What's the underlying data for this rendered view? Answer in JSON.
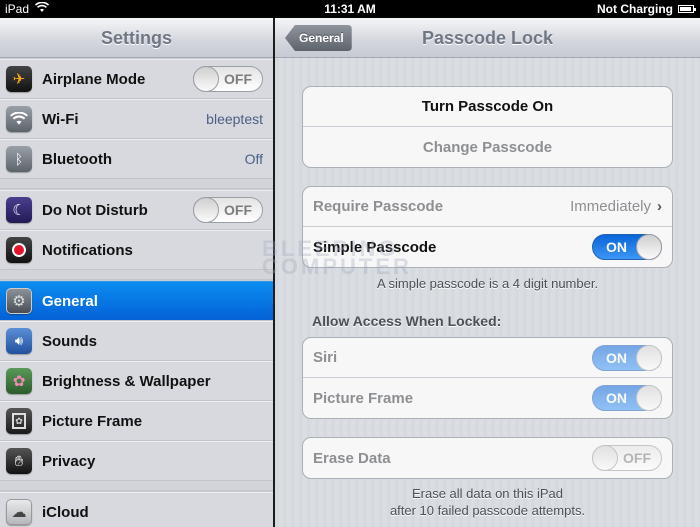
{
  "status_bar": {
    "device": "iPad",
    "time": "11:31 AM",
    "battery_text": "Not Charging"
  },
  "sidebar": {
    "title": "Settings",
    "groups": [
      [
        {
          "label": "Airplane Mode",
          "icon": "airplane-icon",
          "toggle": "OFF"
        },
        {
          "label": "Wi-Fi",
          "icon": "wifi-icon",
          "value": "bleeptest"
        },
        {
          "label": "Bluetooth",
          "icon": "bluetooth-icon",
          "value": "Off"
        }
      ],
      [
        {
          "label": "Do Not Disturb",
          "icon": "moon-icon",
          "toggle": "OFF"
        },
        {
          "label": "Notifications",
          "icon": "notifications-icon"
        }
      ],
      [
        {
          "label": "General",
          "icon": "gear-icon",
          "selected": true
        },
        {
          "label": "Sounds",
          "icon": "speaker-icon"
        },
        {
          "label": "Brightness & Wallpaper",
          "icon": "flower-icon"
        },
        {
          "label": "Picture Frame",
          "icon": "picture-frame-icon"
        },
        {
          "label": "Privacy",
          "icon": "hand-icon"
        }
      ],
      [
        {
          "label": "iCloud",
          "icon": "cloud-icon"
        }
      ]
    ]
  },
  "detail": {
    "back_label": "General",
    "title": "Passcode Lock",
    "passcode_group": {
      "turn_on": "Turn Passcode On",
      "change": "Change Passcode"
    },
    "options_group": {
      "require_label": "Require Passcode",
      "require_value": "Immediately",
      "simple_label": "Simple Passcode",
      "simple_state": "ON"
    },
    "simple_note": "A simple passcode is a 4 digit number.",
    "locked_header": "Allow Access When Locked:",
    "locked_group": {
      "siri_label": "Siri",
      "siri_state": "ON",
      "frame_label": "Picture Frame",
      "frame_state": "ON"
    },
    "erase_label": "Erase Data",
    "erase_state": "OFF",
    "erase_note_1": "Erase all data on this iPad",
    "erase_note_2": "after 10 failed passcode attempts."
  },
  "watermark": {
    "line1": "BLEEPING",
    "line2": "COMPUTER"
  }
}
